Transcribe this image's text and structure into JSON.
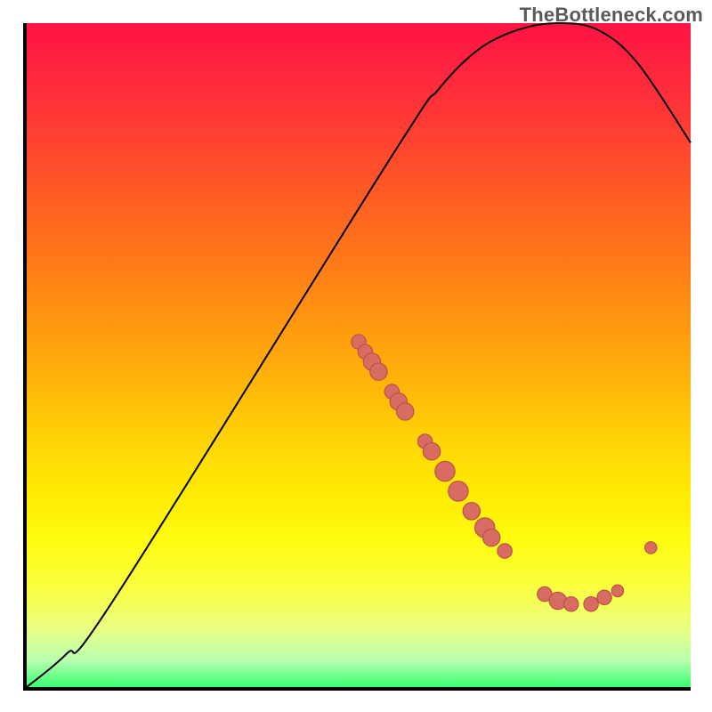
{
  "watermark": "TheBottleneck.com",
  "colors": {
    "curve": "#000000",
    "point_fill": "#d86c63",
    "point_stroke": "#b94f47"
  },
  "chart_data": {
    "type": "line",
    "title": "",
    "xlabel": "",
    "ylabel": "",
    "xlim": [
      0,
      100
    ],
    "ylim": [
      0,
      100
    ],
    "curve_svg": [
      [
        0,
        0
      ],
      [
        6,
        5
      ],
      [
        13,
        13
      ],
      [
        55,
        80
      ],
      [
        62,
        90
      ],
      [
        68,
        96
      ],
      [
        74,
        99
      ],
      [
        80,
        100
      ],
      [
        86,
        99
      ],
      [
        92,
        94
      ],
      [
        100,
        82
      ]
    ],
    "points": [
      {
        "x": 50,
        "y": 48,
        "r": 1.1
      },
      {
        "x": 51,
        "y": 49.5,
        "r": 1.1
      },
      {
        "x": 52,
        "y": 51,
        "r": 1.3
      },
      {
        "x": 53,
        "y": 52.5,
        "r": 1.3
      },
      {
        "x": 55,
        "y": 55.5,
        "r": 1.1
      },
      {
        "x": 56,
        "y": 57,
        "r": 1.3
      },
      {
        "x": 57,
        "y": 58.5,
        "r": 1.3
      },
      {
        "x": 60,
        "y": 63,
        "r": 1.1
      },
      {
        "x": 61,
        "y": 64.5,
        "r": 1.3
      },
      {
        "x": 63,
        "y": 67.5,
        "r": 1.5
      },
      {
        "x": 65,
        "y": 70.5,
        "r": 1.5
      },
      {
        "x": 67,
        "y": 73.5,
        "r": 1.3
      },
      {
        "x": 69,
        "y": 76,
        "r": 1.5
      },
      {
        "x": 70,
        "y": 77.5,
        "r": 1.3
      },
      {
        "x": 72,
        "y": 79.5,
        "r": 1.1
      },
      {
        "x": 78,
        "y": 86,
        "r": 1.1
      },
      {
        "x": 80,
        "y": 87,
        "r": 1.3
      },
      {
        "x": 82,
        "y": 87.5,
        "r": 1.1
      },
      {
        "x": 85,
        "y": 87.5,
        "r": 1.1
      },
      {
        "x": 87,
        "y": 86.5,
        "r": 1.1
      },
      {
        "x": 89,
        "y": 85.5,
        "r": 0.9
      },
      {
        "x": 94,
        "y": 79,
        "r": 0.9
      }
    ]
  }
}
